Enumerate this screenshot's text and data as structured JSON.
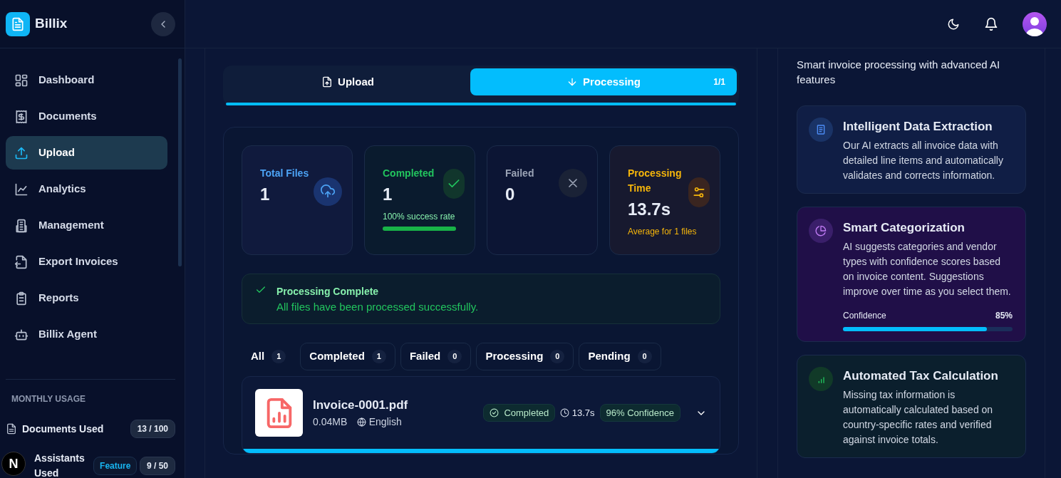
{
  "app": {
    "name": "Billix"
  },
  "sidebar": {
    "items": [
      {
        "label": "Dashboard",
        "selected": false
      },
      {
        "label": "Documents",
        "selected": false
      },
      {
        "label": "Upload",
        "selected": true
      },
      {
        "label": "Analytics",
        "selected": false
      },
      {
        "label": "Management",
        "selected": false
      },
      {
        "label": "Export Invoices",
        "selected": false
      },
      {
        "label": "Reports",
        "selected": false
      },
      {
        "label": "Billix Agent",
        "selected": false
      }
    ]
  },
  "usage": {
    "title": "MONTHLY USAGE",
    "items": [
      {
        "label": "Documents Used",
        "count": "13 / 100"
      },
      {
        "label": "Assistants Used",
        "badge": "Feature",
        "count": "9 / 50"
      }
    ]
  },
  "dev_badge": "N",
  "steps": [
    {
      "label": "Upload",
      "selected": false
    },
    {
      "label": "Processing",
      "selected": true,
      "count": "1/1"
    }
  ],
  "steps_progress": {
    "level": 1
  },
  "stats": [
    {
      "kind": "total",
      "label": "Total Files",
      "value": "1"
    },
    {
      "kind": "completed",
      "label": "Completed",
      "value": "1",
      "note": "100% success rate",
      "level": 1
    },
    {
      "kind": "failed",
      "label": "Failed",
      "value": "0"
    },
    {
      "kind": "time",
      "label": "Processing Time",
      "value": "13.7s",
      "note": "Average for 1 files"
    }
  ],
  "alert": {
    "title": "Processing Complete",
    "message": "All files have been processed successfully."
  },
  "filters": [
    {
      "label": "All",
      "count": "1",
      "selected": true
    },
    {
      "label": "Completed",
      "count": "1",
      "selected": false
    },
    {
      "label": "Failed",
      "count": "0",
      "selected": false
    },
    {
      "label": "Processing",
      "count": "0",
      "selected": false
    },
    {
      "label": "Pending",
      "count": "0",
      "selected": false
    }
  ],
  "files": [
    {
      "name": "Invoice-0001.pdf",
      "size": "0.04MB",
      "language": "English",
      "status": "Completed",
      "duration": "13.7s",
      "confidence": "96% Confidence",
      "level": 1
    }
  ],
  "features": {
    "subtitle": "Smart invoice processing with advanced AI features",
    "cards": [
      {
        "kind": "extraction",
        "title": "Intelligent Data Extraction",
        "text": "Our AI extracts all invoice data with detailed line items and automatically validates and corrects information."
      },
      {
        "kind": "categorization",
        "title": "Smart Categorization",
        "text": "AI suggests categories and vendor types with confidence scores based on invoice content. Suggestions improve over time as you select them.",
        "meter": {
          "label": "Confidence",
          "reading": "85%",
          "level": 0.85
        }
      },
      {
        "kind": "tax",
        "title": "Automated Tax Calculation",
        "text": "Missing tax information is automatically calculated based on country-specific rates and verified against invoice totals."
      }
    ]
  }
}
